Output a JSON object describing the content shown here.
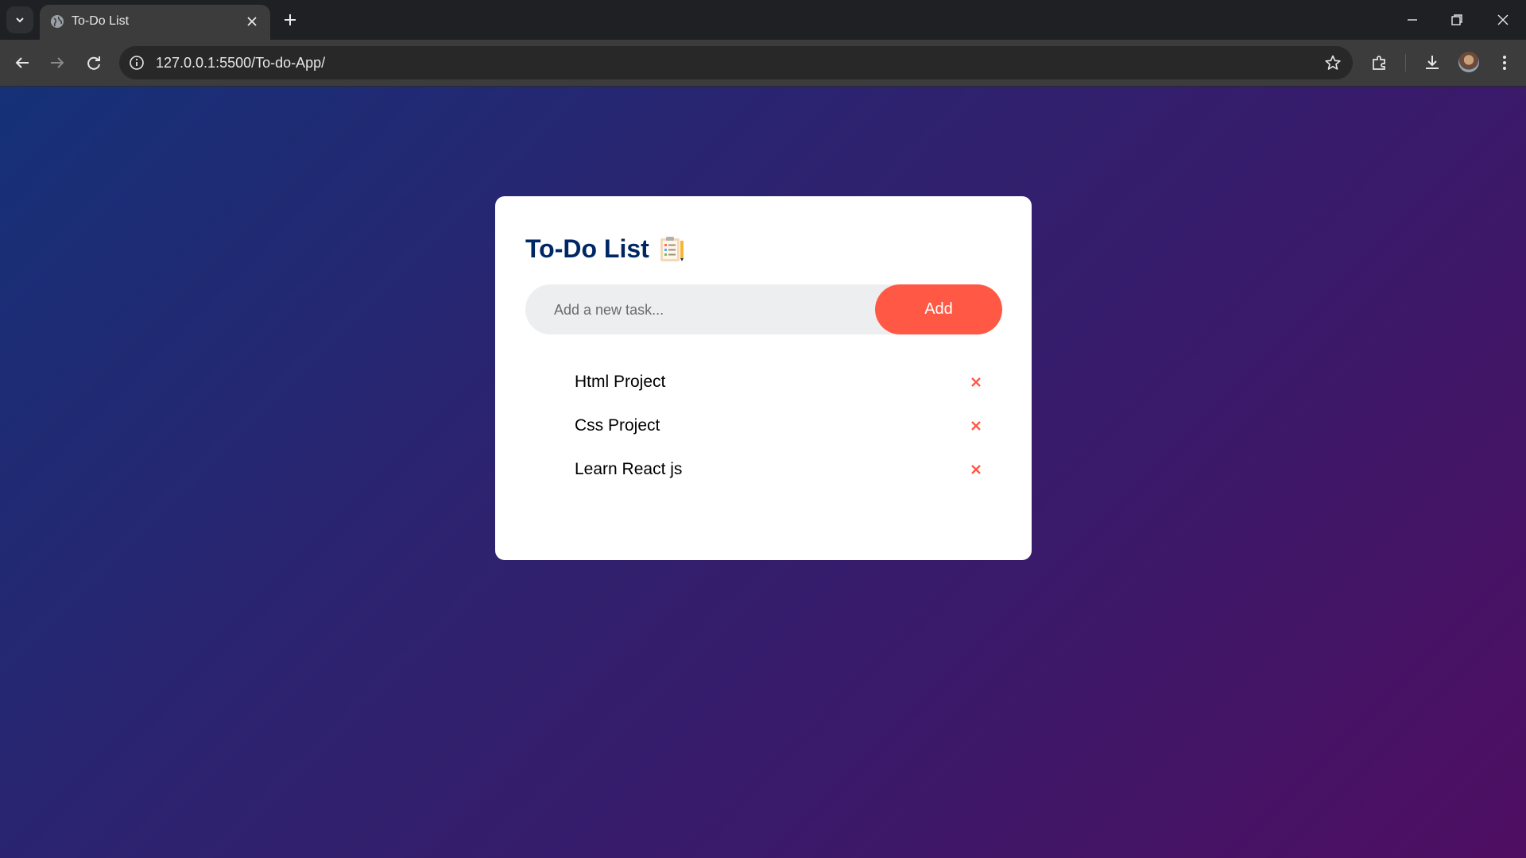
{
  "browser": {
    "tab_title": "To-Do List",
    "url": "127.0.0.1:5500/To-do-App/"
  },
  "app": {
    "title": "To-Do List",
    "title_icon": "clipboard-checklist-emoji",
    "input_placeholder": "Add a new task...",
    "input_value": "",
    "add_label": "Add",
    "accent_color": "#ff5945",
    "title_color": "#002765",
    "tasks": [
      {
        "text": "Html Project",
        "remove_icon": "close-icon"
      },
      {
        "text": "Css Project",
        "remove_icon": "close-icon"
      },
      {
        "text": "Learn React js",
        "remove_icon": "close-icon"
      }
    ]
  }
}
